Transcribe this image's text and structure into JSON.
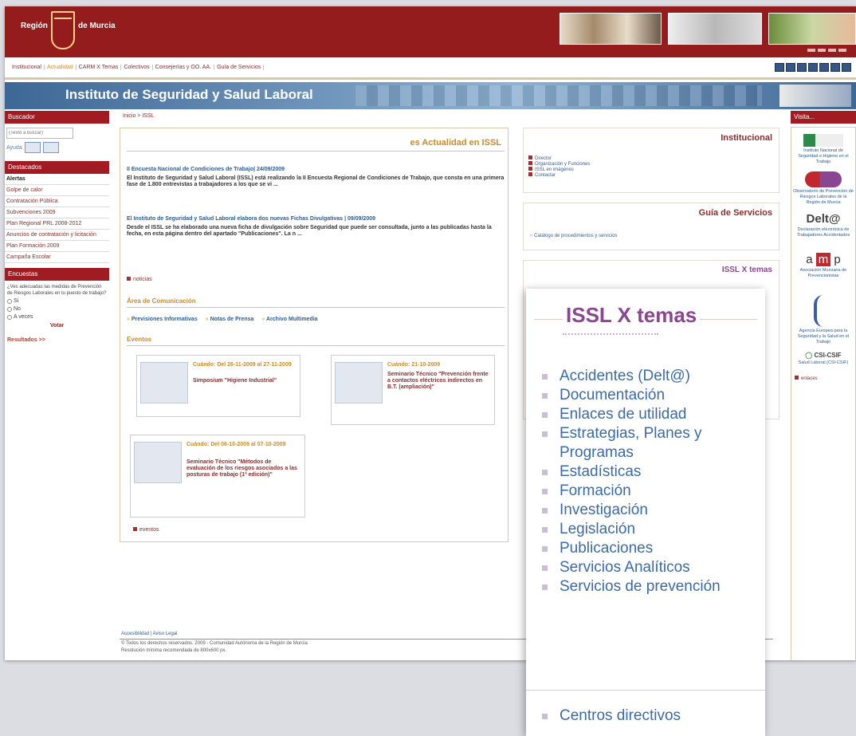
{
  "header": {
    "logo_left": "Región",
    "logo_right": "de Murcia"
  },
  "topnav": {
    "links": [
      "Institucional",
      "Actualidad",
      "CARM X Temas",
      "Colectivos",
      "Consejerías y OO. AA.",
      "Guía de Servicios"
    ]
  },
  "banner": {
    "title": "Instituto de Seguridad y Salud Laboral"
  },
  "left": {
    "buscador_title": "Buscador",
    "search_placeholder": "(Texto a buscar)",
    "help_label": "Ayuda",
    "destacados_title": "Destacados",
    "destacados": [
      "Alertas",
      "Golpe de calor",
      "Contratación Pública",
      "Subvenciones 2009",
      "Plan Regional PRL 2008-2012",
      "Anuncios de contratación y licitación",
      "Plan Formación 2009",
      "Campaña Escolar"
    ],
    "encuestas_title": "Encuestas",
    "poll_question": "¿Ves adecuadas las medidas de Prevención de Riesgos Laborales en tu puesto de trabajo?",
    "poll_options": [
      "Si",
      "No",
      "A veces"
    ],
    "vote_label": "Votar",
    "results_label": "Resultados >>"
  },
  "breadcrumb": "Inicio > ISSL",
  "main": {
    "section_title": "es Actualidad en ISSL",
    "news": [
      {
        "title": "II Encuesta Nacional de Condiciones de Trabajo| 24/09/2009",
        "body": "El Instituto de Seguridad y Salud Laboral (ISSL) está realizando la II Encuesta Regional de Condiciones de Trabajo, que consta en una primera fase de 1.800 entrevistas a trabajadores a los que se vi ..."
      },
      {
        "title": "El Instituto de Seguridad y Salud Laboral elabora dos nuevas Fichas Divulgativas | 09/09/2009",
        "body": "Desde el ISSL se ha elaborado una nueva ficha de divulgación sobre Seguridad que puede ser consultada, junto a las publicadas hasta la fecha, en esta página dentro del apartado \"Publicaciones\". La n ..."
      }
    ],
    "news_link": "noticias",
    "comm_title": "Área de Comunicación",
    "comm_links": [
      "Previsiones Informativas",
      "Notas de Prensa",
      "Archivo Multimedia"
    ],
    "events_title": "Eventos",
    "events": [
      {
        "when": "Cuándo: Del 26-11-2009 al 27-11-2009",
        "desc": "Simposium \"Higiene Industrial\""
      },
      {
        "when": "Cuándo: 21-10-2009",
        "desc": "Seminario Técnico \"Prevención frente a contactos eléctricos indirectos en B.T. (ampliación)\""
      },
      {
        "when": "Cuándo: Del 06-10-2009 al 07-10-2009",
        "desc": "Seminario Técnico \"Métodos de evaluación de los riesgos asociados a las posturas de trabajo (1ª edición)\""
      }
    ],
    "events_link": "eventos"
  },
  "institucional": {
    "title": "Institucional",
    "links": [
      "Director",
      "Organización y Funciones",
      "ISSL en imágenes",
      "Contactar"
    ]
  },
  "guia": {
    "title": "Guía de Servicios",
    "link": "Catálogo de procedimientos y servicios"
  },
  "issl_small_title": "ISSL X temas",
  "visita": {
    "title": "Visita...",
    "items": [
      "Instituto Nacional de Seguridad e Higiene en el Trabajo",
      "Observatorio de Prevención de Riesgos Laborales de la Región de Murcia",
      "Declaración electrónica de Trabajadores Accidentados",
      "Asociación Murciana de Prevencionistas",
      "Agencia Europea para la Seguridad y la Salud en el Trabajo",
      "Salud Laboral (CSI-CSIF)"
    ],
    "delt_logo": "Delt@",
    "amp_logo": [
      "a",
      "m",
      "p"
    ],
    "csif_logo": "CSI-CSIF",
    "enlaces": "enlaces"
  },
  "footer": {
    "line1": "Accesibilidad | Aviso Legal",
    "line2": "© Todos los derechos reservados. 2009 - Comunidad Autónoma de la Región de Murcia",
    "line3": "Resolución mínima recomendada de 800x600 px."
  },
  "zoom": {
    "title": "ISSL X temas",
    "items": [
      "Accidentes (Delt@)",
      "Documentación",
      "Enlaces de utilidad",
      "Estrategias, Planes y Programas",
      "Estadísticas",
      "Formación",
      "Investigación",
      "Legislación",
      "Publicaciones",
      "Servicios Analíticos",
      "Servicios de prevención"
    ],
    "extra": "Centros directivos"
  }
}
